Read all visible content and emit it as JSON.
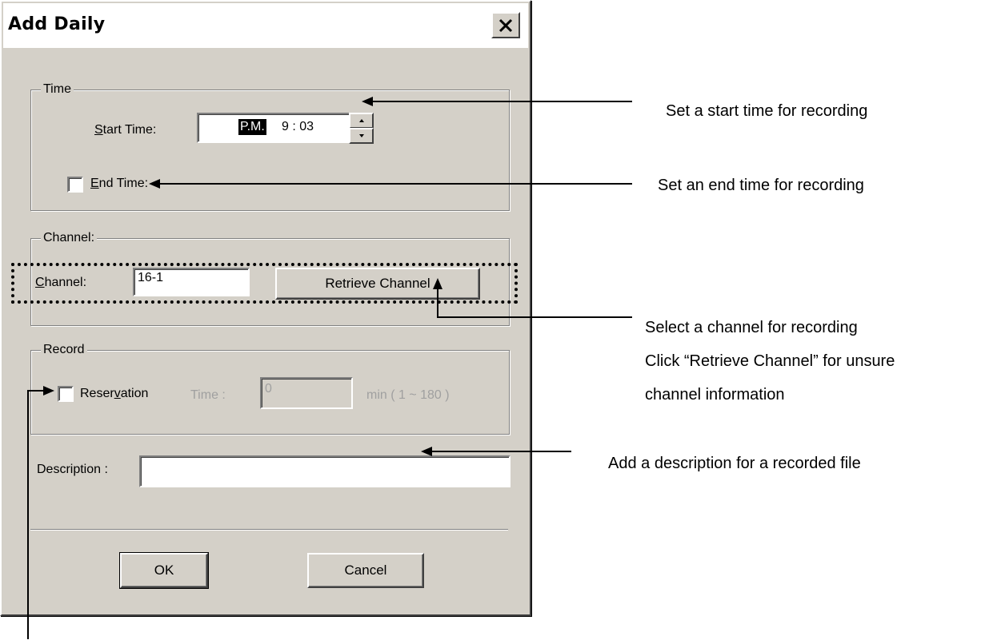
{
  "dialog": {
    "title": "Add Daily"
  },
  "time_group": {
    "legend": "Time",
    "start_time": {
      "label_prefix": "",
      "label_ul": "S",
      "label_rest": "tart Time:",
      "ampm": "P.M.",
      "value": "9 : 03"
    },
    "end_time": {
      "label_ul": "E",
      "label_rest": "nd Time:",
      "checked": false
    }
  },
  "channel_group": {
    "legend": "Channel:",
    "label_ul": "C",
    "label_rest": "hannel:",
    "value": "16-1",
    "retrieve_button": "Retrieve Channel"
  },
  "record_group": {
    "legend": "Record",
    "reservation": {
      "pre": "Reser",
      "ul": "v",
      "post": "ation",
      "checked": false
    },
    "time_label": "Time :",
    "time_value": "0",
    "range": "min ( 1 ~ 180 )"
  },
  "description": {
    "label": "Description :",
    "value": ""
  },
  "buttons": {
    "ok": "OK",
    "cancel": "Cancel"
  },
  "annotations": {
    "start_time": "Set a start time for recording",
    "end_time": "Set an end time for recording",
    "channel_line1": "Select a channel for recording",
    "channel_line2": "Click “Retrieve Channel” for unsure",
    "channel_line3": "channel information",
    "description": "Add a description for a recorded file"
  },
  "icons": {
    "close": "close-icon",
    "spin_up": "spin-up-icon",
    "spin_down": "spin-down-icon"
  }
}
